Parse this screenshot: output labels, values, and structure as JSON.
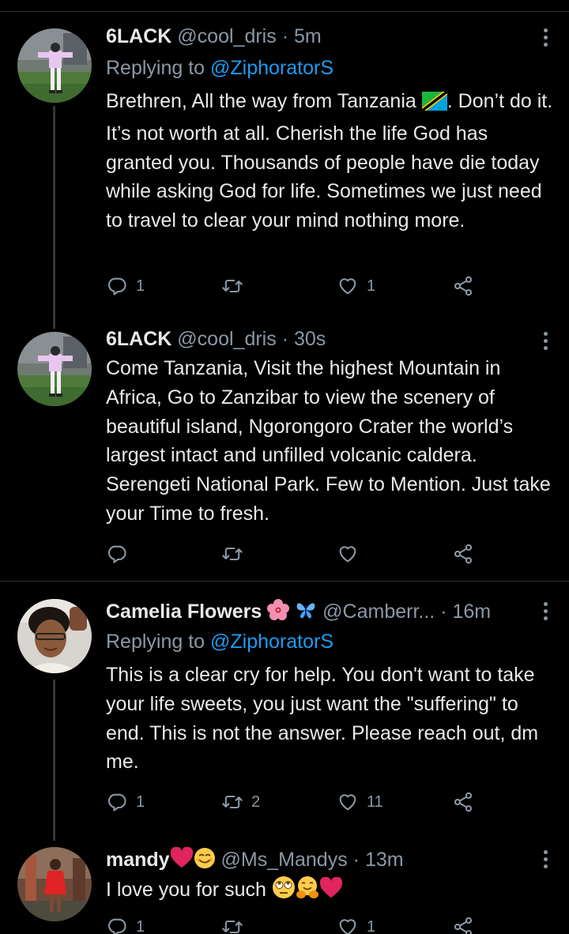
{
  "tweets": [
    {
      "name": "6LACK",
      "handle": "@cool_dris",
      "dot": "·",
      "time": "5m",
      "replying_label": "Replying to",
      "replying_to": "@ZiphoratorS",
      "text_before_flag": "Brethren, All the way from Tanzania",
      "flag": "tanzania-flag-emoji",
      "text_after_flag": ". Don’t do it. It’s not worth at all. Cherish the life God has granted you. Thousands of people have die today while asking God for life. Sometimes we just need to travel to clear your mind nothing more.",
      "reply_count": "1",
      "retweet_count": "",
      "like_count": "1"
    },
    {
      "name": "6LACK",
      "handle": "@cool_dris",
      "dot": "·",
      "time": "30s",
      "text": "Come Tanzania, Visit the highest Mountain in Africa, Go to Zanzibar to view the scenery of beautiful island, Ngorongoro Crater the world’s largest intact and unfilled volcanic caldera. Serengeti National Park. Few to Mention. Just take your Time to fresh.",
      "reply_count": "",
      "retweet_count": "",
      "like_count": ""
    },
    {
      "name": "Camelia Flowers",
      "name_emojis": [
        "hibiscus-emoji",
        "butterfly-emoji"
      ],
      "handle": "@Camberr...",
      "dot": "·",
      "time": "16m",
      "replying_label": "Replying to",
      "replying_to": "@ZiphoratorS",
      "text": "This is a clear cry for help. You don't want to take your life sweets, you just want the \"suffering\" to end. This is not the answer. Please reach out, dm me.",
      "reply_count": "1",
      "retweet_count": "2",
      "like_count": "11"
    },
    {
      "name": "mandy",
      "name_emojis": [
        "red-heart-emoji",
        "smiling-face-emoji"
      ],
      "handle": "@Ms_Mandys",
      "dot": "·",
      "time": "13m",
      "text": "I love you for such",
      "text_emojis": [
        "rolling-eyes-emoji",
        "hugging-face-emoji",
        "red-heart-emoji"
      ],
      "reply_count": "1",
      "retweet_count": "",
      "like_count": "1"
    }
  ],
  "icons": {
    "reply": "reply-icon",
    "retweet": "retweet-icon",
    "like": "heart-icon",
    "share": "share-icon",
    "more": "more-icon"
  },
  "colors": {
    "background": "#000000",
    "text": "#e7e9ea",
    "secondary": "#8b98a5",
    "link": "#1d9bf0",
    "divider": "#2f3336"
  }
}
